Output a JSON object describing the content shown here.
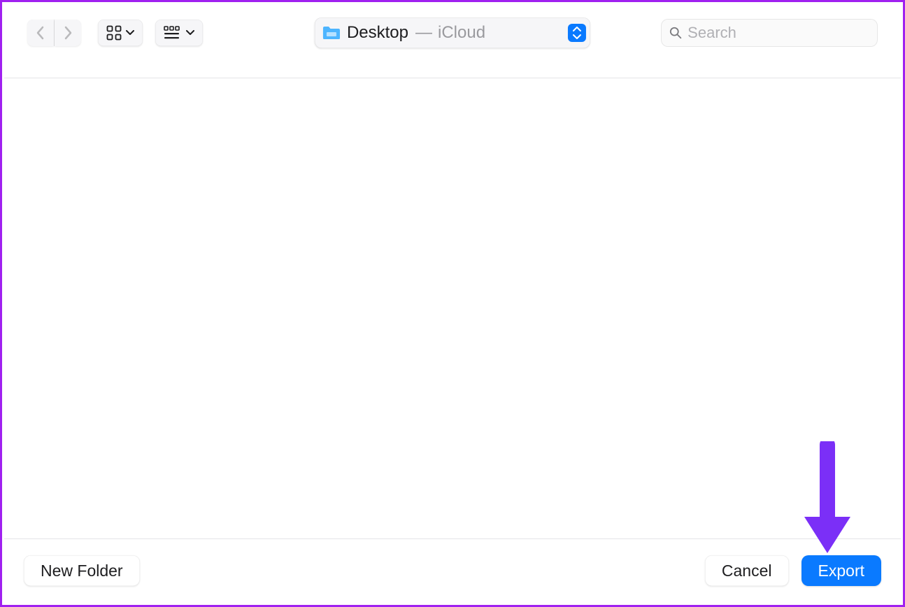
{
  "toolbar": {
    "location": {
      "folder_name": "Desktop",
      "separator": " — ",
      "source": "iCloud"
    },
    "search": {
      "placeholder": "Search",
      "value": ""
    }
  },
  "footer": {
    "new_folder_label": "New Folder",
    "cancel_label": "Cancel",
    "export_label": "Export"
  },
  "annotation": {
    "arrow_color": "#7b2ff7"
  }
}
